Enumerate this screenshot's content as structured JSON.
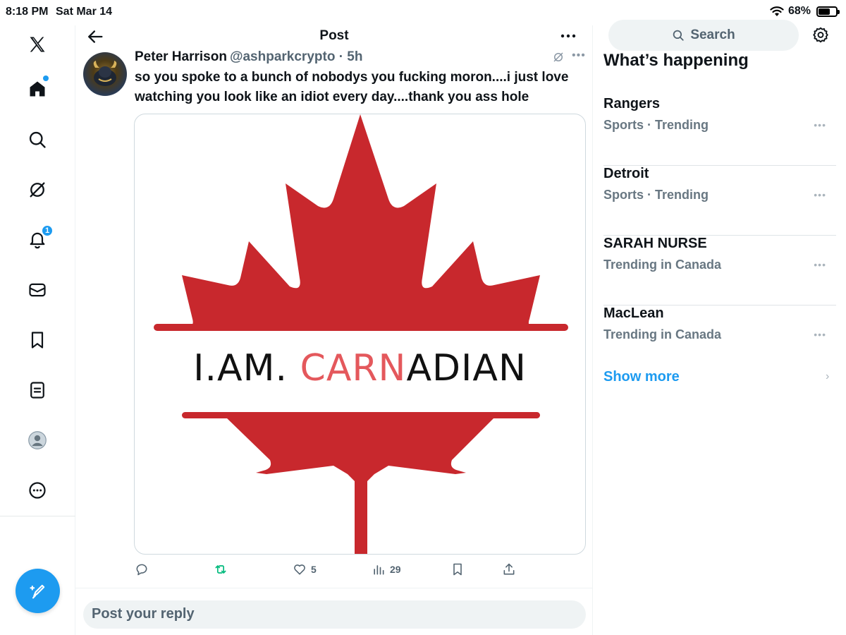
{
  "status_bar": {
    "time": "8:18 PM",
    "date": "Sat Mar 14",
    "battery": "68%",
    "battery_level": 0.68
  },
  "nav": {
    "items": [
      "x-logo",
      "home",
      "search",
      "grok",
      "notifications",
      "messages",
      "bookmarks",
      "lists",
      "profile",
      "more"
    ],
    "notification_count": "1"
  },
  "header": {
    "title": "Post"
  },
  "post": {
    "author_name": "Peter Harrison",
    "author_handle": "@ashparkcrypto · 5h",
    "text": "so you spoke to a bunch of nobodys you fucking moron....i just love watching you look like an idiot every day....thank you ass hole",
    "image_caption": {
      "part1": "I.AM. ",
      "highlight": "CARN",
      "part2": "ADIAN"
    },
    "likes": "5",
    "views": "29"
  },
  "reply": {
    "placeholder": "Post your reply"
  },
  "sidebar": {
    "search_label": "Search",
    "section_title": "What’s happening",
    "trends": [
      {
        "name": "Rangers",
        "meta": "Sports · Trending"
      },
      {
        "name": "Detroit",
        "meta": "Sports · Trending"
      },
      {
        "name": "SARAH NURSE",
        "meta": "Trending in Canada"
      },
      {
        "name": "MacLean",
        "meta": "Trending in Canada"
      }
    ],
    "show_more": "Show more"
  },
  "colors": {
    "accent": "#1d9bf0",
    "maple_red": "#c8282d",
    "repost_green": "#00ba7c"
  }
}
